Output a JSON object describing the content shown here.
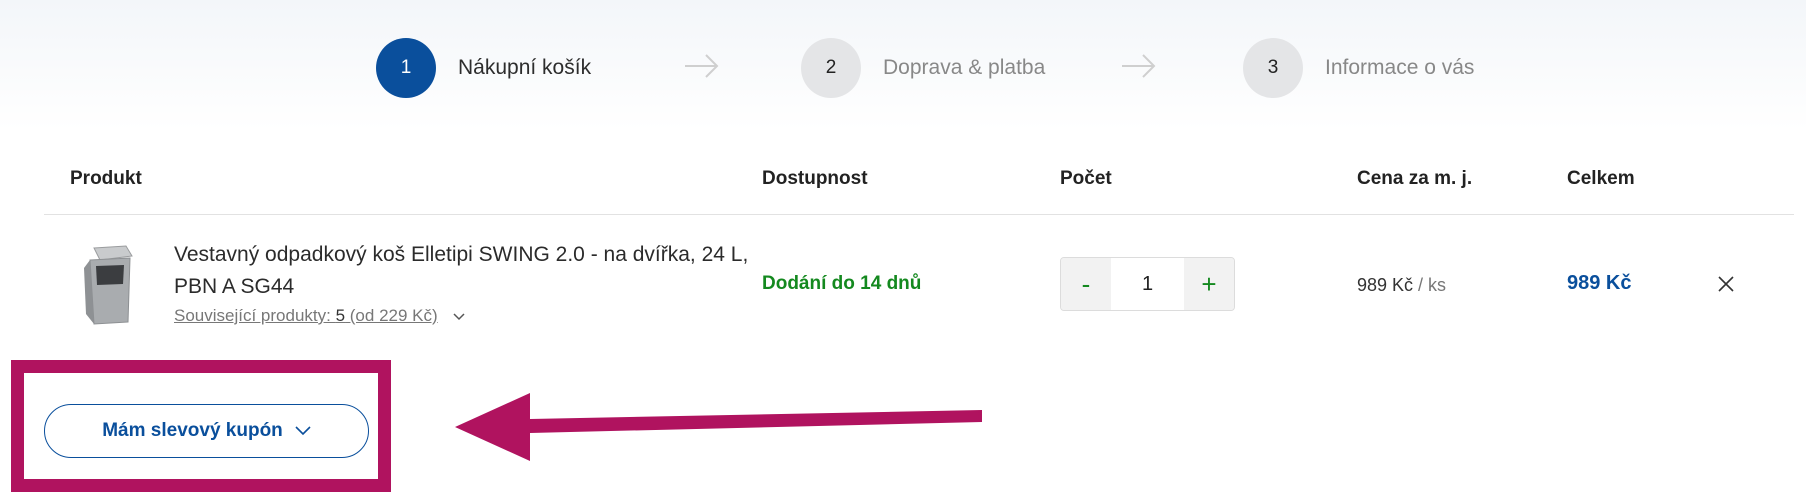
{
  "steps": [
    {
      "number": "1",
      "label": "Nákupní košík",
      "active": true
    },
    {
      "number": "2",
      "label": "Doprava & platba",
      "active": false
    },
    {
      "number": "3",
      "label": "Informace o vás",
      "active": false
    }
  ],
  "table_headers": {
    "product": "Produkt",
    "availability": "Dostupnost",
    "quantity": "Počet",
    "unit_price": "Cena za m. j.",
    "total": "Celkem"
  },
  "item": {
    "name": "Vestavný odpadkový koš Elletipi SWING 2.0 - na dvířka, 24 L, PBN A SG44",
    "related_prefix": "Související produkty: ",
    "related_count": "5",
    "related_suffix": " (od 229 Kč)",
    "availability": "Dodání do 14 dnů",
    "qty_minus": "-",
    "qty_value": "1",
    "qty_plus": "+",
    "unit_price": "989 Kč",
    "unit_suffix": " / ks",
    "total": "989 Kč"
  },
  "coupon": {
    "label": "Mám slevový kupón"
  },
  "colors": {
    "primary": "#0a4f9c",
    "success": "#14891f",
    "annotation": "#b0135f"
  }
}
